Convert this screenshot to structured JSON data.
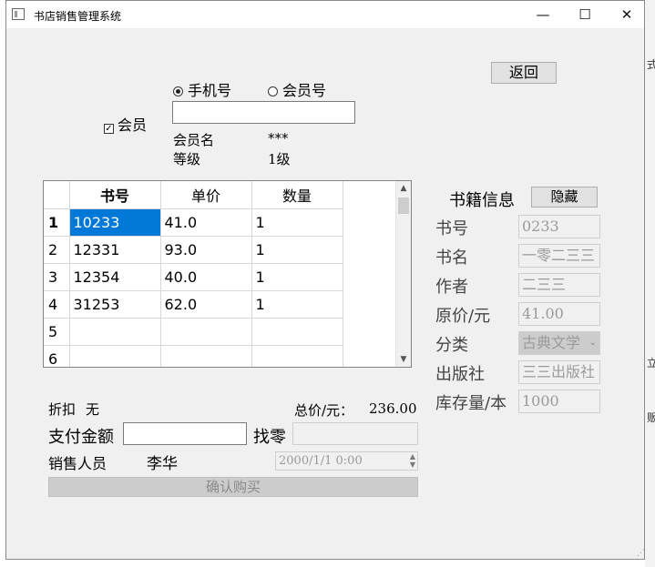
{
  "window": {
    "title": "书店销售管理系统",
    "minimize": "—",
    "maximize": "☐",
    "close": "✕"
  },
  "back_button": "返回",
  "member": {
    "radio_phone": "手机号",
    "radio_member_no": "会员号",
    "checkbox_label": "会员",
    "input_value": "",
    "name_label": "会员名",
    "name_value": "***",
    "level_label": "等级",
    "level_value": "1级"
  },
  "table": {
    "headers": [
      "书号",
      "单价",
      "数量"
    ],
    "rows": [
      {
        "num": "1",
        "book_no": "10233",
        "price": "41.0",
        "qty": "1"
      },
      {
        "num": "2",
        "book_no": "12331",
        "price": "93.0",
        "qty": "1"
      },
      {
        "num": "3",
        "book_no": "12354",
        "price": "40.0",
        "qty": "1"
      },
      {
        "num": "4",
        "book_no": "31253",
        "price": "62.0",
        "qty": "1"
      },
      {
        "num": "5",
        "book_no": "",
        "price": "",
        "qty": ""
      },
      {
        "num": "6",
        "book_no": "",
        "price": "",
        "qty": ""
      }
    ]
  },
  "book_info": {
    "title": "书籍信息",
    "hide_button": "隐藏",
    "fields": [
      {
        "label": "书号",
        "value": "0233"
      },
      {
        "label": "书名",
        "value": "一零二三三"
      },
      {
        "label": "作者",
        "value": "二三三"
      },
      {
        "label": "原价/元",
        "value": "41.00"
      },
      {
        "label": "分类",
        "value": "古典文学"
      },
      {
        "label": "出版社",
        "value": "三三出版社"
      },
      {
        "label": "库存量/本",
        "value": "1000"
      }
    ]
  },
  "summary": {
    "discount_label": "折扣",
    "discount_value": "无",
    "total_label": "总价/元：",
    "total_value": "236.00",
    "pay_label": "支付金额",
    "pay_value": "",
    "change_label": "找零",
    "change_value": "",
    "seller_label": "销售人员",
    "seller_value": "李华",
    "datetime": "2000/1/1 0:00",
    "confirm_button": "确认购买"
  },
  "background": {
    "snippets": [
      "式",
      "立",
      "贩"
    ]
  }
}
